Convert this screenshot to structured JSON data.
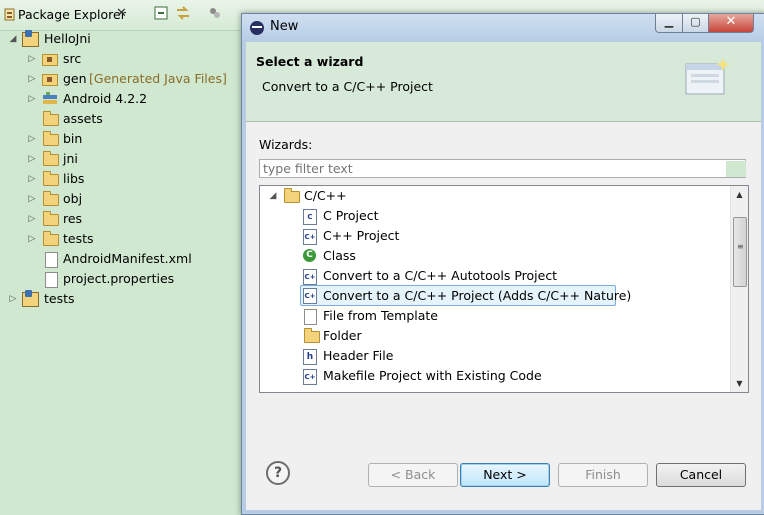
{
  "explorer": {
    "title": "Package Explorer",
    "close_glyph": "✕",
    "toolbar": [
      "collapse-all-icon",
      "link-with-editor-icon",
      "view-menu-icon"
    ],
    "tree": [
      {
        "label": "HelloJni",
        "twist": "◢",
        "icon": "project-icon"
      },
      {
        "label": "src",
        "twist": "▷",
        "icon": "package-folder-icon"
      },
      {
        "label": "gen",
        "extra": "[Generated Java Files]",
        "twist": "▷",
        "icon": "package-folder-icon"
      },
      {
        "label": "Android 4.2.2",
        "twist": "▷",
        "icon": "library-icon"
      },
      {
        "label": "assets",
        "twist": "",
        "icon": "folder-icon"
      },
      {
        "label": "bin",
        "twist": "▷",
        "icon": "folder-icon"
      },
      {
        "label": "jni",
        "twist": "▷",
        "icon": "folder-icon"
      },
      {
        "label": "libs",
        "twist": "▷",
        "icon": "folder-icon"
      },
      {
        "label": "obj",
        "twist": "▷",
        "icon": "folder-icon"
      },
      {
        "label": "res",
        "twist": "▷",
        "icon": "folder-icon"
      },
      {
        "label": "tests",
        "twist": "▷",
        "icon": "folder-icon"
      },
      {
        "label": "AndroidManifest.xml",
        "twist": "",
        "icon": "xml-file-icon"
      },
      {
        "label": "project.properties",
        "twist": "",
        "icon": "file-icon"
      },
      {
        "label": "tests",
        "twist": "▷",
        "icon": "project-icon"
      }
    ]
  },
  "dialog": {
    "title": "New",
    "banner_title": "Select a wizard",
    "banner_desc": "Convert to a C/C++ Project",
    "wizards_label": "Wizards:",
    "filter_placeholder": "type filter text",
    "tree": [
      {
        "label": "C/C++",
        "twist": "◢",
        "icon": "folder-icon"
      },
      {
        "label": "C Project",
        "icon": "c-project-icon"
      },
      {
        "label": "C++ Project",
        "icon": "cpp-project-icon"
      },
      {
        "label": "Class",
        "icon": "class-icon"
      },
      {
        "label": "Convert to a C/C++ Autotools Project",
        "icon": "convert-icon"
      },
      {
        "label": "Convert to a C/C++ Project (Adds C/C++ Nature)",
        "icon": "convert-icon",
        "selected": true
      },
      {
        "label": "File from Template",
        "icon": "file-icon"
      },
      {
        "label": "Folder",
        "icon": "folder-icon"
      },
      {
        "label": "Header File",
        "icon": "header-file-icon"
      },
      {
        "label": "Makefile Project with Existing Code",
        "icon": "makefile-icon"
      }
    ],
    "buttons": {
      "back": "< Back",
      "next": "Next >",
      "finish": "Finish",
      "cancel": "Cancel"
    },
    "help_glyph": "?"
  }
}
